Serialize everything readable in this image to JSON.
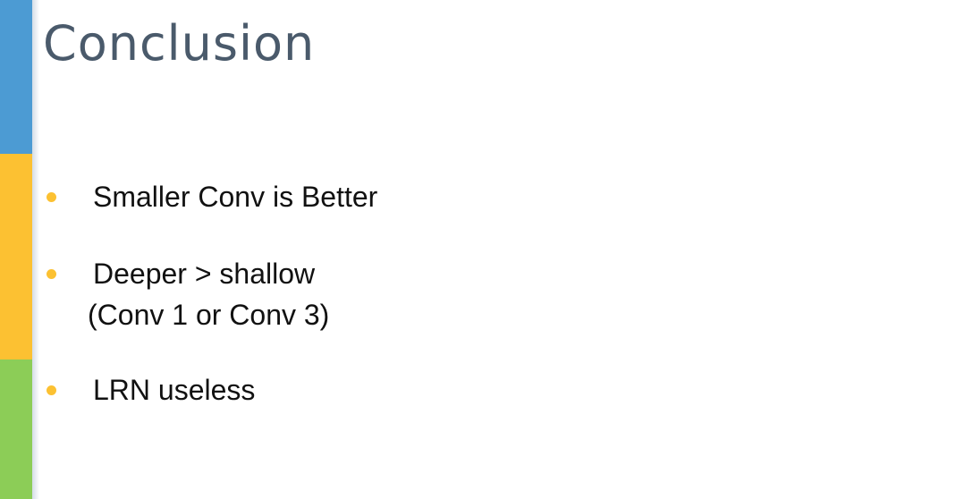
{
  "slide": {
    "title": "Conclusion",
    "accent_colors": {
      "band_top": "#4c9bd3",
      "band_middle": "#fcc132",
      "band_bottom": "#8ccd57",
      "bullet": "#fcc132"
    },
    "bullets": [
      {
        "text": "Smaller Conv is Better",
        "sub": ""
      },
      {
        "text": "Deeper > shallow",
        "sub": "(Conv 1 or Conv 3)"
      },
      {
        "text": "LRN useless",
        "sub": ""
      }
    ]
  }
}
